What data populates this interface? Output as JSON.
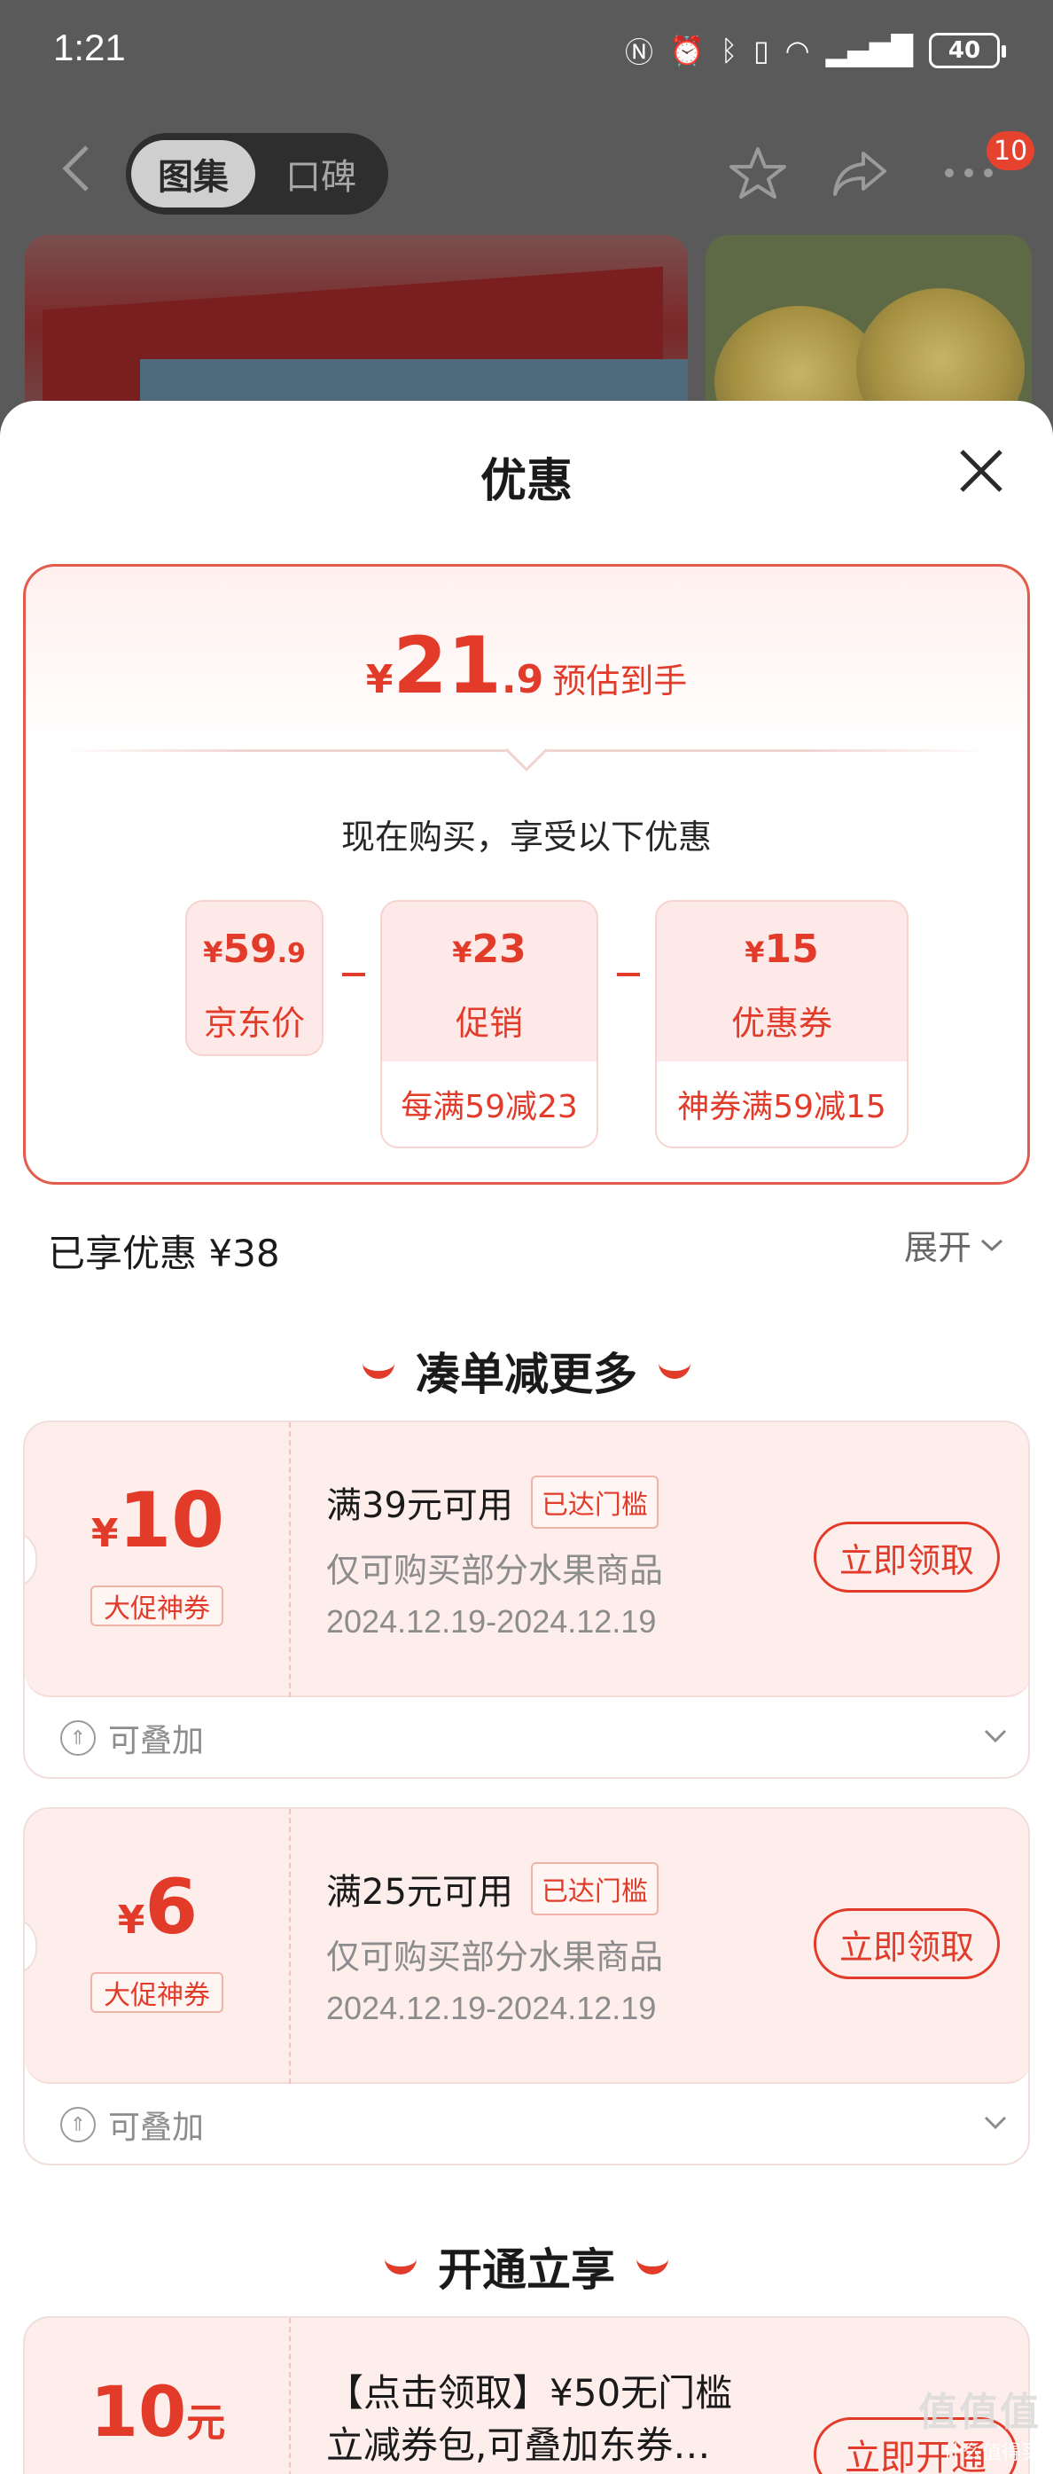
{
  "status_bar": {
    "time": "1:21",
    "battery": "40"
  },
  "nav": {
    "tabs": [
      {
        "label": "图集",
        "active": true
      },
      {
        "label": "口碑",
        "active": false
      }
    ],
    "badge_count": "10"
  },
  "sheet": {
    "title": "优惠",
    "estimate": {
      "currency": "¥",
      "integer": "21",
      "decimal": ".9",
      "label": "预估到手"
    },
    "buy_now_text": "现在购买，享受以下优惠",
    "breakdown": {
      "jd_price": {
        "currency": "¥",
        "integer": "59",
        "decimal": ".9",
        "label": "京东价"
      },
      "promotion": {
        "currency": "¥",
        "amount": "23",
        "label": "促销",
        "detail": "每满59减23"
      },
      "coupon": {
        "currency": "¥",
        "amount": "15",
        "label": "优惠券",
        "detail": "神券满59减15"
      }
    },
    "saved": {
      "label": "已享优惠",
      "amount": "¥38"
    },
    "expand_label": "展开"
  },
  "section_more": {
    "title": "凑单减更多",
    "coupons": [
      {
        "currency": "¥",
        "amount": "10",
        "tag": "大促神券",
        "condition": "满39元可用",
        "reached": "已达门槛",
        "scope": "仅可购买部分水果商品",
        "date": "2024.12.19-2024.12.19",
        "button": "立即领取",
        "stack_label": "可叠加"
      },
      {
        "currency": "¥",
        "amount": "6",
        "tag": "大促神券",
        "condition": "满25元可用",
        "reached": "已达门槛",
        "scope": "仅可购买部分水果商品",
        "date": "2024.12.19-2024.12.19",
        "button": "立即领取",
        "stack_label": "可叠加"
      }
    ]
  },
  "section_open": {
    "title": "开通立享",
    "coupon": {
      "amount": "10",
      "unit": "元",
      "desc_line1": "【点击领取】¥50无门槛",
      "desc_line2": "立减券包,可叠加东券…",
      "button": "立即开通"
    }
  },
  "watermark": {
    "brand": "值值值",
    "site": "什么值得买"
  },
  "colors": {
    "accent": "#e33b2a",
    "coupon_bg": "#fdeeec",
    "border": "#e35b4c"
  },
  "icons": [
    "back-arrow-icon",
    "star-icon",
    "share-icon",
    "more-icon",
    "close-icon",
    "chevron-down-icon",
    "stack-icon"
  ]
}
